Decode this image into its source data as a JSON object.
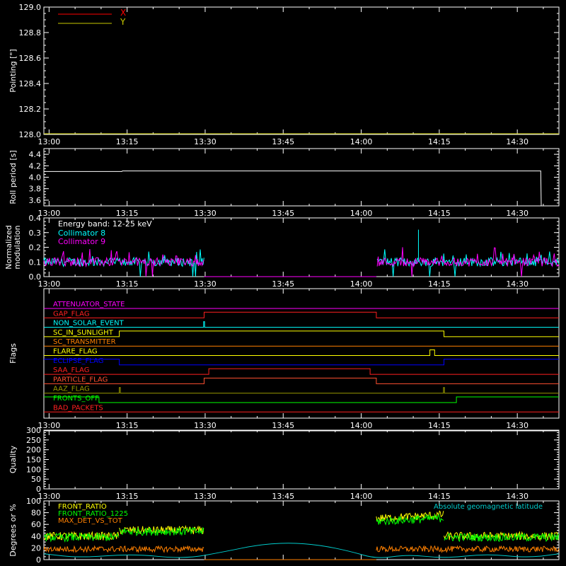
{
  "time_ticks": [
    "13:00",
    "13:15",
    "13:30",
    "13:45",
    "14:00",
    "14:15",
    "14:30"
  ],
  "time_tick_values_min": [
    780,
    795,
    810,
    825,
    840,
    855,
    870
  ],
  "time_range_min": [
    779,
    878
  ],
  "colors": {
    "background": "#000000",
    "axes": "#ffffff",
    "x_pointing": "#ff0000",
    "y_pointing": "#c8c800",
    "collimator_8": "#00ffff",
    "collimator_9": "#ff00ff",
    "front_ratio": "#ffff00",
    "front_ratio_1225": "#00ff00",
    "max_det_vs_tot": "#ff8000",
    "geomag_lat": "#00cccc"
  },
  "chart_data": [
    {
      "id": "pointing",
      "type": "line",
      "ylabel": "Pointing [\"]",
      "ylim": [
        128.0,
        129.0
      ],
      "yticks": [
        "128.0",
        "128.2",
        "128.4",
        "128.6",
        "128.8",
        "129.0"
      ],
      "yticks_values": [
        128.0,
        128.2,
        128.4,
        128.6,
        128.8,
        129.0
      ],
      "legend": {
        "placement": "top-left"
      },
      "series": [
        {
          "name": "X",
          "color": "#ff0000",
          "x": [
            779,
            878
          ],
          "y": [
            128.0,
            128.0
          ]
        },
        {
          "name": "Y",
          "color": "#c8c800",
          "x": [
            779,
            878
          ],
          "y": [
            128.0,
            128.0
          ]
        }
      ]
    },
    {
      "id": "roll",
      "type": "line",
      "ylabel": "Roll period [s]",
      "ylim": [
        3.5,
        4.5
      ],
      "yticks": [
        "3.6",
        "3.8",
        "4.0",
        "4.2",
        "4.4"
      ],
      "yticks_values": [
        3.6,
        3.8,
        4.0,
        4.2,
        4.4
      ],
      "series": [
        {
          "name": "",
          "color": "#ffffff",
          "x": [
            779,
            794,
            794.1,
            874.5,
            874.6
          ],
          "y": [
            4.1,
            4.1,
            4.11,
            4.11,
            3.5
          ]
        }
      ]
    },
    {
      "id": "modulation",
      "type": "line",
      "ylabel_lines": [
        "Normalized",
        "modulation"
      ],
      "ylim": [
        0.0,
        0.4
      ],
      "yticks": [
        "0.0",
        "0.1",
        "0.2",
        "0.3",
        "0.4"
      ],
      "yticks_values": [
        0.0,
        0.1,
        0.2,
        0.3,
        0.4
      ],
      "annotation": "Energy band: 12-25 keV",
      "legend": {
        "placement": "top-left"
      },
      "gaps_min": [
        [
          809.8,
          842.9
        ]
      ],
      "series": [
        {
          "name": "Collimator 8",
          "color": "#00ffff",
          "baseline": 0.1
        },
        {
          "name": "Collimator 9",
          "color": "#ff00ff",
          "baseline": 0.1
        }
      ]
    },
    {
      "id": "flags",
      "type": "line",
      "ylabel": "Flags",
      "flags": [
        {
          "name": "ATTENUATOR_STATE",
          "color": "#ff00ff",
          "steps": [
            [
              779,
              0
            ],
            [
              878,
              0
            ]
          ]
        },
        {
          "name": "GAP_FLAG",
          "color": "#ff2020",
          "steps": [
            [
              779,
              0
            ],
            [
              809.8,
              1
            ],
            [
              842.9,
              0
            ],
            [
              878,
              0
            ]
          ]
        },
        {
          "name": "NON_SOLAR_EVENT",
          "color": "#00ffff",
          "steps": [
            [
              779,
              0
            ],
            [
              809.7,
              1
            ],
            [
              809.9,
              0
            ],
            [
              878,
              0
            ]
          ]
        },
        {
          "name": "SC_IN_SUNLIGHT",
          "color": "#ffff00",
          "steps": [
            [
              779,
              0
            ],
            [
              793.5,
              1
            ],
            [
              855.9,
              0
            ],
            [
              878,
              0
            ]
          ]
        },
        {
          "name": "SC_TRANSMITTER",
          "color": "#ff8000",
          "steps": [
            [
              779,
              0
            ],
            [
              878,
              0
            ]
          ]
        },
        {
          "name": "FLARE_FLAG",
          "color": "#ffff00",
          "steps": [
            [
              779,
              0
            ],
            [
              853.2,
              1
            ],
            [
              854.1,
              0
            ],
            [
              878,
              0
            ]
          ]
        },
        {
          "name": "ECLIPSE_FLAG",
          "color": "#0000ff",
          "steps": [
            [
              779,
              1
            ],
            [
              793.5,
              0
            ],
            [
              855.9,
              1
            ],
            [
              878,
              1
            ]
          ]
        },
        {
          "name": "SAA_FLAG",
          "color": "#ff2020",
          "steps": [
            [
              779,
              0
            ],
            [
              810.7,
              1
            ],
            [
              841.7,
              0
            ],
            [
              878,
              0
            ]
          ]
        },
        {
          "name": "PARTICLE_FLAG",
          "color": "#ff5030",
          "steps": [
            [
              779,
              0
            ],
            [
              809.8,
              1
            ],
            [
              842.9,
              0
            ],
            [
              878,
              0
            ]
          ]
        },
        {
          "name": "AAZ_FLAG",
          "color": "#999900",
          "steps": [
            [
              779,
              0
            ],
            [
              793.5,
              1
            ],
            [
              793.7,
              0
            ],
            [
              855.8,
              1
            ],
            [
              856.0,
              0
            ],
            [
              878,
              0
            ]
          ]
        },
        {
          "name": "FRONTS_OFF",
          "color": "#00ff00",
          "steps": [
            [
              779,
              1
            ],
            [
              789.6,
              0
            ],
            [
              858.3,
              1
            ],
            [
              878,
              1
            ]
          ]
        },
        {
          "name": "BAD_PACKETS",
          "color": "#ff2020",
          "steps": [
            [
              779,
              0
            ],
            [
              878,
              0
            ]
          ]
        }
      ]
    },
    {
      "id": "quality",
      "type": "line",
      "ylabel": "Quality",
      "ylim": [
        0,
        300
      ],
      "yticks": [
        "0",
        "50",
        "100",
        "150",
        "200",
        "250",
        "300"
      ],
      "yticks_values": [
        0,
        50,
        100,
        150,
        200,
        250,
        300
      ],
      "series": [
        {
          "name": "",
          "color": "#ffffff",
          "x": [
            779,
            878
          ],
          "y": [
            300,
            300
          ]
        }
      ]
    },
    {
      "id": "ratios",
      "type": "line",
      "ylabel": "Degrees or %",
      "ylim": [
        0,
        100
      ],
      "yticks": [
        "0",
        "20",
        "40",
        "60",
        "80",
        "100"
      ],
      "yticks_values": [
        0,
        20,
        40,
        60,
        80,
        100
      ],
      "legend": {
        "placement": "top-left"
      },
      "gaps_min": [
        [
          809.8,
          842.9
        ]
      ],
      "series": [
        {
          "name": "FRONT_RATIO",
          "color": "#ffff00",
          "segments": [
            [
              779,
              793.5,
              40
            ],
            [
              793.5,
              809.8,
              50
            ],
            [
              842.9,
              855.9,
              70
            ],
            [
              855.9,
              878,
              40
            ]
          ]
        },
        {
          "name": "FRONT_RATIO_1225",
          "color": "#00ff00",
          "segments": [
            [
              779,
              793.5,
              38
            ],
            [
              793.5,
              809.8,
              48
            ],
            [
              842.9,
              855.9,
              65
            ],
            [
              855.9,
              878,
              38
            ]
          ]
        },
        {
          "name": "MAX_DET_VS_TOT",
          "color": "#ff8000",
          "segments": [
            [
              779,
              809.8,
              18
            ],
            [
              842.9,
              878,
              18
            ]
          ]
        },
        {
          "name": "Absolute geomagnetic latitude",
          "color": "#00cccc",
          "x": [
            779,
            786,
            796,
            806,
            814,
            820,
            826,
            832,
            838,
            843,
            849,
            856,
            864,
            872,
            878
          ],
          "y": [
            10,
            3,
            10,
            1,
            14,
            25,
            29,
            25,
            14,
            1,
            9,
            2,
            10,
            3,
            10
          ]
        }
      ]
    }
  ]
}
